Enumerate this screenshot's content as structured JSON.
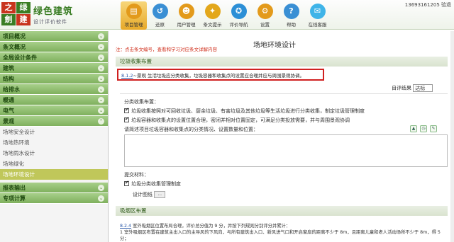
{
  "brand": {
    "logo_chars": [
      "之",
      "绿",
      "劍",
      "建"
    ],
    "name": "绿色建筑",
    "tagline": "设计评价软件"
  },
  "header": {
    "nav": [
      {
        "label": "项目管理",
        "icon": "folder-icon",
        "color": "#e39a1b"
      },
      {
        "label": "还原",
        "icon": "undo-icon",
        "color": "#3a8fd4"
      },
      {
        "label": "用户管理",
        "icon": "user-icon",
        "color": "#e39a1b"
      },
      {
        "label": "条文提示",
        "icon": "bulb-icon",
        "color": "#e3a71b"
      },
      {
        "label": "评价导航",
        "icon": "compass-icon",
        "color": "#2c8fd6"
      },
      {
        "label": "设置",
        "icon": "gear-icon",
        "color": "#e39a1b"
      },
      {
        "label": "帮助",
        "icon": "help-icon",
        "color": "#3a8fd4"
      },
      {
        "label": "在线客服",
        "icon": "chat-icon",
        "color": "#3fb4e8"
      }
    ],
    "user": "13693161205 验退"
  },
  "sidebar": {
    "items": [
      {
        "label": "项目概况",
        "type": "head"
      },
      {
        "label": "条文概况",
        "type": "head"
      },
      {
        "label": "全局设计条件",
        "type": "head"
      },
      {
        "label": "建筑",
        "type": "head"
      },
      {
        "label": "结构",
        "type": "head"
      },
      {
        "label": "给排水",
        "type": "head"
      },
      {
        "label": "暖通",
        "type": "head"
      },
      {
        "label": "电气",
        "type": "head"
      },
      {
        "label": "景观",
        "type": "head"
      },
      {
        "label": "场地安全设计",
        "type": "sub"
      },
      {
        "label": "场地热环境",
        "type": "sub"
      },
      {
        "label": "场地雨水设计",
        "type": "sub"
      },
      {
        "label": "场地绿化",
        "type": "sub"
      },
      {
        "label": "场地环境设计",
        "type": "sub",
        "selected": true
      },
      {
        "label": "报表输出",
        "type": "head"
      },
      {
        "label": "专项计算",
        "type": "head"
      }
    ]
  },
  "main": {
    "title": "场地环境设计",
    "note": "注：点击条文编号，查看和学习对应条文详解内容",
    "section1": "垃圾收集布置",
    "req_code": "8.1.2",
    "req_text": "~景观 生活垃圾应分类收集，垃圾容器和收集点的设置应合理并应与周围景观协调。",
    "result_label": "自评结果",
    "result_value": "达标",
    "classify_label": "分类收集布置：",
    "check1": "垃圾收集按照对可回收垃圾、厨余垃圾、有害垃圾及其他垃圾等生活垃圾进行分类收集，制定垃圾管理制度",
    "check2": "垃圾容器和收集点的设置位置合理，密闭并相对位置固定，可满足分类投放需要，并与周围景观协调",
    "prompt": "请简述项目垃圾容器和收集点的分类情况、设置数量和位置：",
    "submit_label": "提交材料：",
    "check3": "垃圾分类收集管理制度",
    "drawing_label": "设计图纸",
    "drawing_btn": "...",
    "section2": "吸烟区布置",
    "smoke_code": "8.2.4",
    "smoke_text1": "室外吸烟区位置布局合理，评价总分值为 9 分，并按下列规则分别评分并累计：",
    "smoke_text2": "1 室外吸烟区布置在建筑主出入口的主导风的下风向，与所有建筑出入口、新风进气口和开启窗扇的距离不少于 8m，且距离儿童和老人活动场所不少于 8m，得 5 分；"
  }
}
